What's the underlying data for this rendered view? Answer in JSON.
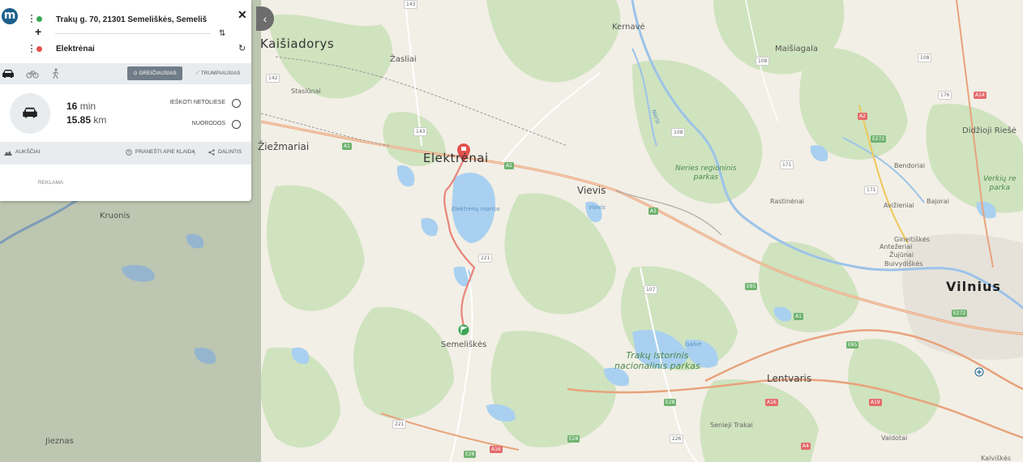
{
  "panel": {
    "logo_letter": "m",
    "origin": "Trakų g. 70, 21301 Semeliškės, Semeliš",
    "destination": "Elektrėnai",
    "close_symbol": "✕",
    "plus_symbol": "+",
    "swap_symbol": "⇅",
    "refresh_symbol": "↻",
    "modes": [
      {
        "icon": "car-icon",
        "active": true
      },
      {
        "icon": "bicycle-icon",
        "active": false
      },
      {
        "icon": "walk-icon",
        "active": false
      }
    ],
    "fastest_label": "⊙ GREIČIAUSIAS",
    "shortest_label": "⟋ TRUMPIAUSIAS",
    "duration_value": "16",
    "duration_unit": "min",
    "distance_value": "15.85",
    "distance_unit": "km",
    "search_nearby": "IEŠKOTI NETOLIESE",
    "directions": "NUORODOS",
    "elevation": "AUKŠČIAI",
    "report_error": "PRANEŠTI APIE KLAIDĄ",
    "share": "DALINTIS",
    "ad": "REKLAMA",
    "colors": {
      "accent": "#1d5f8c",
      "origin_pin": "#3aa655",
      "dest_pin": "#e2504c",
      "route": "#e8847a"
    }
  },
  "map": {
    "places": {
      "kaisiadorys": "Kaišiadorys",
      "kernave": "Kernavė",
      "zasliai": "Žasliai",
      "maisiagala": "Maišiagala",
      "stasiunai": "Stasiūnai",
      "ziezmariai": "Žiežmariai",
      "elektrenai": "Elektrėnai",
      "vievis": "Vievis",
      "kruonis": "Kruonis",
      "rastinenai": "Rastinėnai",
      "bendoriai": "Bendoriai",
      "didzioji_riese": "Didžioji Riešė",
      "aviziniai": "Avižieniai",
      "bajorai": "Bajorai",
      "gineitiskes": "Gineitiškės",
      "anteziaria": "Antežeriai",
      "zujunai": "Žujūnai",
      "buivydiskes": "Buivydiškės",
      "vilnius": "Vilnius",
      "semeliskes": "Semeliškės",
      "lentvaris": "Lentvaris",
      "senieji_trakai": "Senieji Trakai",
      "jieznas": "Jieznas",
      "valdotai": "Valdotai",
      "kalviskes": "Kalviškės"
    },
    "parks": {
      "neris": "Neries regioninis\nparkas",
      "trakai": "Trakų istorinis\nnacionalinis parkas",
      "verkiu": "Verkių re\nparka"
    },
    "water": {
      "elektrenu_marios": "Elektrėnų marios",
      "neris": "Neris",
      "vievis_lake": "Vievis",
      "galve": "Galvė"
    },
    "shields": [
      "A1",
      "A1",
      "A1",
      "A1",
      "A2",
      "A14",
      "A16",
      "A16",
      "A19",
      "E28",
      "E28",
      "E28",
      "E85",
      "E85",
      "E272",
      "E272",
      "108",
      "108",
      "108",
      "107",
      "143",
      "143",
      "142",
      "171",
      "171",
      "176",
      "221",
      "221",
      "226",
      "A4"
    ]
  }
}
